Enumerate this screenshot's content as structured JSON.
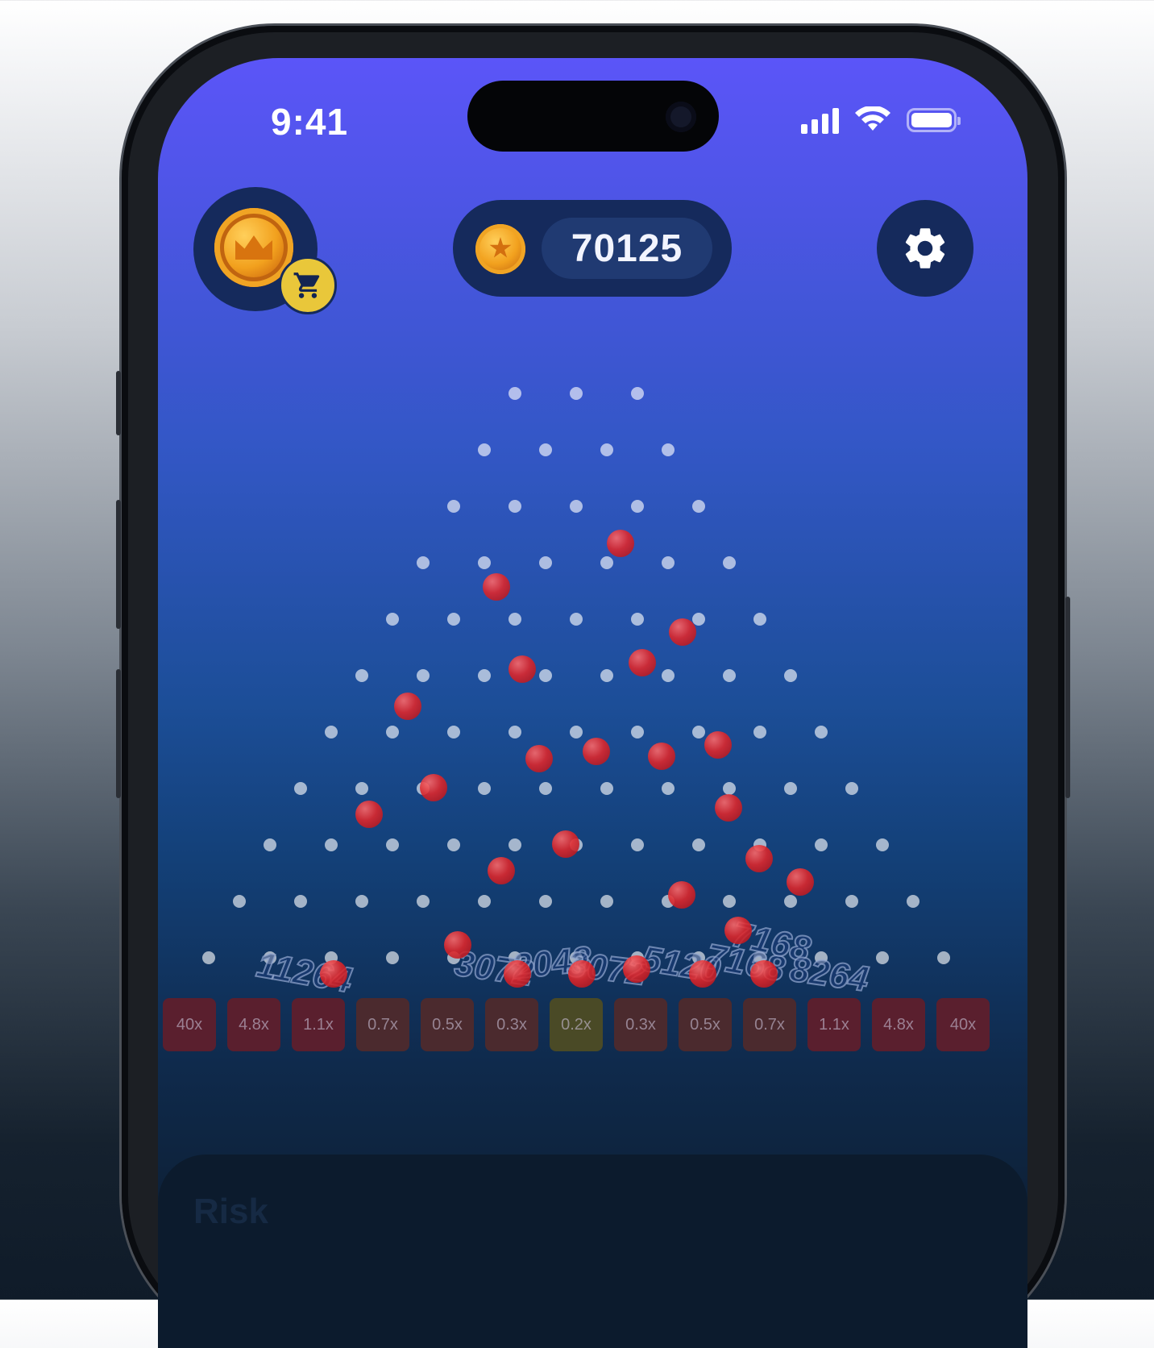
{
  "status_bar": {
    "time": "9:41"
  },
  "header": {
    "balance": "70125"
  },
  "board": {
    "floating_wins": [
      "11264",
      "3072",
      "2048",
      "3072",
      "5120",
      "7168",
      "7168",
      "8264"
    ]
  },
  "multipliers": [
    {
      "label": "40x",
      "color": "#5a1f2e"
    },
    {
      "label": "4.8x",
      "color": "#5a1f2e"
    },
    {
      "label": "1.1x",
      "color": "#5a1f2e"
    },
    {
      "label": "0.7x",
      "color": "#4b2a2e"
    },
    {
      "label": "0.5x",
      "color": "#4b2a2e"
    },
    {
      "label": "0.3x",
      "color": "#4b2a2e"
    },
    {
      "label": "0.2x",
      "color": "#4a4a26"
    },
    {
      "label": "0.3x",
      "color": "#4b2a2e"
    },
    {
      "label": "0.5x",
      "color": "#4b2a2e"
    },
    {
      "label": "0.7x",
      "color": "#4b2a2e"
    },
    {
      "label": "1.1x",
      "color": "#5a1f2e"
    },
    {
      "label": "4.8x",
      "color": "#5a1f2e"
    },
    {
      "label": "40x",
      "color": "#5a1f2e"
    }
  ],
  "risk_panel": {
    "label": "Risk"
  },
  "icons": {
    "shop": "coin-shop-icon",
    "cart": "cart-icon",
    "settings": "gear-icon"
  }
}
